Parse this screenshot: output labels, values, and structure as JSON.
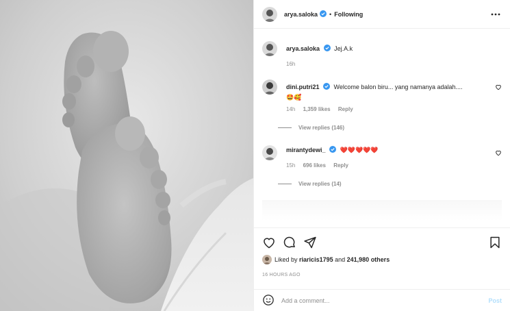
{
  "post": {
    "username": "arya.saloka",
    "follow_separator": "•",
    "follow_status": "Following",
    "more_icon": "more-horizontal-icon"
  },
  "caption": {
    "username": "arya.saloka",
    "text": "Jej.A.k",
    "time": "16h"
  },
  "comments": [
    {
      "username": "dini.putri21",
      "text": "Welcome balon biru... yang namanya adalah....",
      "emoji": "🤩🥰",
      "time": "14h",
      "likes": "1,359 likes",
      "reply_label": "Reply",
      "view_replies": "View replies (146)"
    },
    {
      "username": "mirantydewi_",
      "text": "❤️❤️❤️❤️❤️",
      "time": "15h",
      "likes": "696 likes",
      "reply_label": "Reply",
      "view_replies": "View replies (14)"
    }
  ],
  "likes": {
    "prefix": "Liked by",
    "user": "riaricis1795",
    "conj": "and",
    "others": "241,980 others"
  },
  "time_ago": "16 HOURS AGO",
  "add_comment": {
    "placeholder": "Add a comment...",
    "post_label": "Post"
  },
  "colors": {
    "verified": "#3897f0",
    "post_disabled": "#b2dffc",
    "muted": "#8e8e8e",
    "heart_red": "#ed4956"
  }
}
